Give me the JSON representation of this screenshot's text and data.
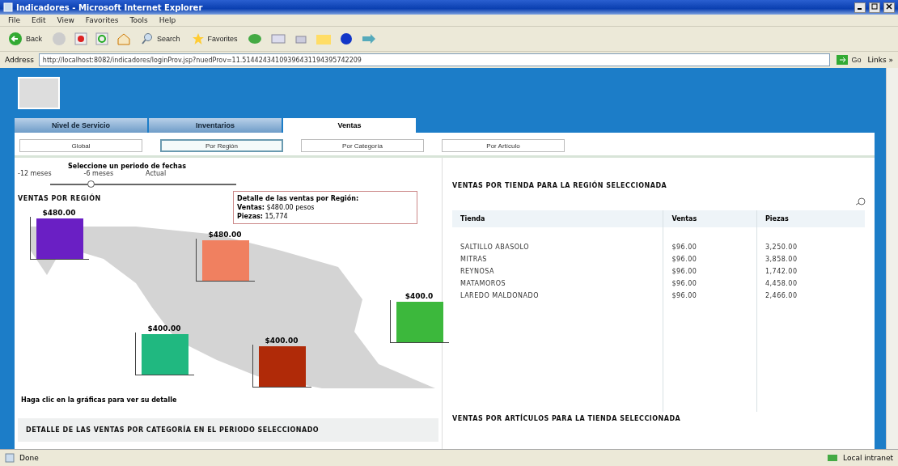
{
  "window": {
    "title": "Indicadores - Microsoft Internet Explorer"
  },
  "menu": [
    "File",
    "Edit",
    "View",
    "Favorites",
    "Tools",
    "Help"
  ],
  "toolbar": {
    "back": "Back",
    "search": "Search",
    "favorites": "Favorites"
  },
  "address": {
    "label": "Address",
    "url": "http://localhost:8082/indicadores/loginProv.jsp?nuedProv=11.51442434109396431194395742209",
    "go": "Go",
    "links": "Links »"
  },
  "tabs": [
    {
      "label": "Nivel de Servicio",
      "selected": false
    },
    {
      "label": "Inventarios",
      "selected": false
    },
    {
      "label": "Ventas",
      "selected": true
    }
  ],
  "subtabs": [
    {
      "label": "Global",
      "selected": false
    },
    {
      "label": "Por Región",
      "selected": true
    },
    {
      "label": "Por Categoría",
      "selected": false
    },
    {
      "label": "Por Artículo",
      "selected": false
    }
  ],
  "period": {
    "title": "Seleccione un periodo de fechas",
    "ticks": [
      "-12 meses",
      "-6 meses",
      "Actual"
    ],
    "level": 0.2
  },
  "regions": {
    "heading": "VENTAS POR REGIÓN",
    "bars": [
      {
        "value": "$480.00",
        "color": "#6a1fc4"
      },
      {
        "value": "$480.00",
        "color": "#f08060"
      },
      {
        "value": "$400.0",
        "color": "#3cb83c"
      },
      {
        "value": "$400.00",
        "color": "#20b880"
      },
      {
        "value": "$400.00",
        "color": "#b02a08"
      }
    ],
    "tooltip": {
      "title": "Detalle de las ventas por Región:",
      "sales_label": "Ventas:",
      "sales": "$480.00 pesos",
      "pieces_label": "Piezas:",
      "pieces": "15,774"
    },
    "hint": "Haga clic en la gráficas para ver su detalle"
  },
  "category_heading": "DETALLE DE LAS VENTAS POR CATEGORÍA EN EL PERIODO SELECCIONADO",
  "stores": {
    "heading": "VENTAS POR TIENDA PARA LA REGIÓN SELECCIONADA",
    "columns": [
      "Tienda",
      "Ventas",
      "Piezas"
    ],
    "rows": [
      [
        "SALTILLO ABASOLO",
        "$96.00",
        "3,250.00"
      ],
      [
        "MITRAS",
        "$96.00",
        "3,858.00"
      ],
      [
        "REYNOSA",
        "$96.00",
        "1,742.00"
      ],
      [
        "MATAMOROS",
        "$96.00",
        "4,458.00"
      ],
      [
        "LAREDO MALDONADO",
        "$96.00",
        "2,466.00"
      ]
    ]
  },
  "articles_heading": "VENTAS POR ARTÍCULOS PARA LA TIENDA SELECCIONADA",
  "status_bar": {
    "text": "Done",
    "zone": "Local intranet"
  }
}
